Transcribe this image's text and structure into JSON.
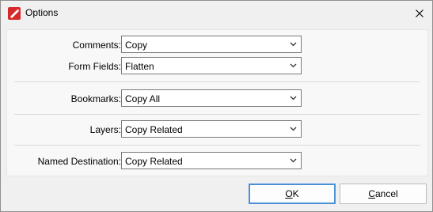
{
  "window": {
    "title": "Options",
    "icon": "pdf-editor-app-icon",
    "close_icon": "close-icon"
  },
  "form": {
    "comments": {
      "label": "Comments:",
      "value": "Copy"
    },
    "form_fields": {
      "label": "Form Fields:",
      "value": "Flatten"
    },
    "bookmarks": {
      "label": "Bookmarks:",
      "value": "Copy All"
    },
    "layers": {
      "label": "Layers:",
      "value": "Copy Related"
    },
    "named_destination": {
      "label": "Named Destination:",
      "value": "Copy Related"
    }
  },
  "buttons": {
    "ok": {
      "mnemonic": "O",
      "rest": "K"
    },
    "cancel": {
      "mnemonic": "C",
      "rest": "ancel"
    }
  },
  "colors": {
    "app_icon": "#d62a2a",
    "focus_border": "#4a90d9"
  }
}
